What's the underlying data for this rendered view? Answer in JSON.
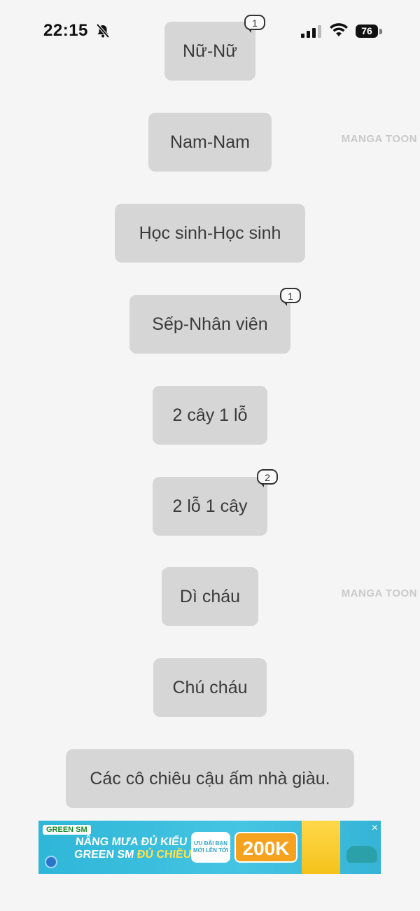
{
  "status_bar": {
    "time": "22:15",
    "battery": "76"
  },
  "watermark": "MANGA TOON",
  "tags": [
    {
      "label": "Nữ-Nữ",
      "badge": "1"
    },
    {
      "label": "Nam-Nam",
      "badge": ""
    },
    {
      "label": "Học sinh-Học sinh",
      "badge": ""
    },
    {
      "label": "Sếp-Nhân viên",
      "badge": "1"
    },
    {
      "label": "2 cây 1 lỗ",
      "badge": ""
    },
    {
      "label": "2 lỗ 1 cây",
      "badge": "2"
    },
    {
      "label": "Dì cháu",
      "badge": ""
    },
    {
      "label": "Chú cháu",
      "badge": ""
    },
    {
      "label": "Các cô chiêu cậu ấm nhà giàu.",
      "badge": ""
    }
  ],
  "ad": {
    "brand": "GREEN SM",
    "headline_line1": "NÂNG MƯA ĐỦ KIỂU",
    "headline_line2_a": "GREEN SM",
    "headline_line2_b": "ĐỦ CHIỀU",
    "promo_label": "ƯU ĐÃI BẠN MỚI LÊN TỚI",
    "amount": "200K",
    "close": "×"
  }
}
